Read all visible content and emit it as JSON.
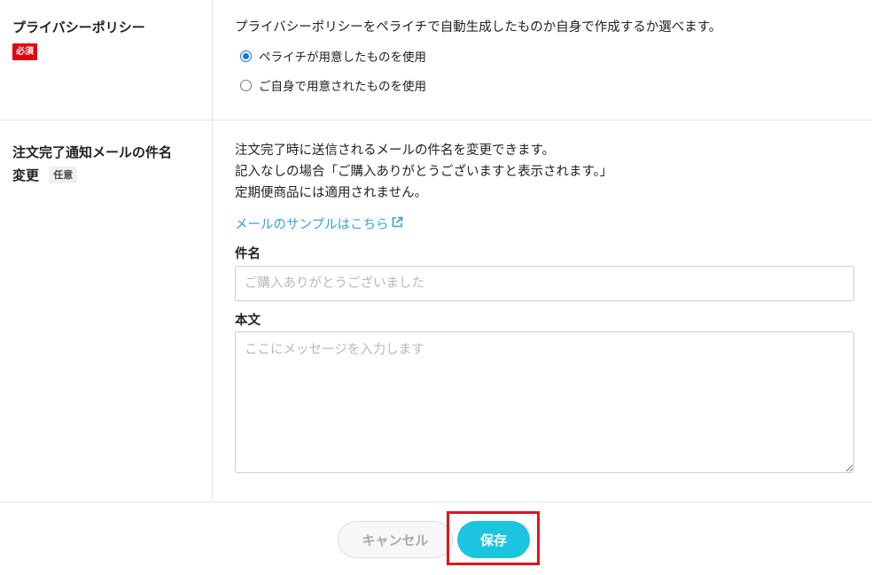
{
  "privacy": {
    "label": "プライバシーポリシー",
    "required_badge": "必須",
    "description": "プライバシーポリシーをペライチで自動生成したものか自身で作成するか選べます。",
    "options": [
      {
        "label": "ペライチが用意したものを使用",
        "checked": true
      },
      {
        "label": "ご自身で用意されたものを使用",
        "checked": false
      }
    ]
  },
  "order_mail": {
    "label_line1": "注文完了通知メールの件名",
    "label_line2": "変更",
    "optional_badge": "任意",
    "desc_lines": [
      "注文完了時に送信されるメールの件名を変更できます。",
      "記入なしの場合「ご購入ありがとうございますと表示されます。」",
      "定期便商品には適用されません。"
    ],
    "sample_link": "メールのサンプルはこちら",
    "subject_label": "件名",
    "subject_placeholder": "ご購入ありがとうございました",
    "body_label": "本文",
    "body_placeholder": "ここにメッセージを入力します"
  },
  "footer": {
    "cancel_label": "キャンセル",
    "save_label": "保存"
  },
  "colors": {
    "required_badge": "#e60012",
    "link": "#3aa0d8",
    "save_button": "#1cc4e0",
    "highlight": "#e0141e",
    "radio_selected": "#1a73e8"
  },
  "icons": {
    "external_link": "external-link-icon"
  }
}
